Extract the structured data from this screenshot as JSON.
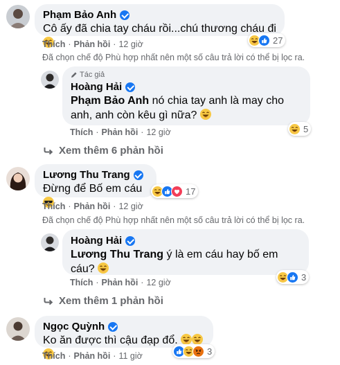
{
  "comments": [
    {
      "author": "Phạm Bảo Anh",
      "text": "Cô ấy đã chia tay cháu rồi...chú thương cháu đi",
      "actions": {
        "like": "Thích",
        "reply": "Phản hồi",
        "time": "12 giờ"
      },
      "reactions_count": "27",
      "filter_note": "Đã chọn chế độ Phù hợp nhất nên một số câu trả lời có thể bị lọc ra.",
      "reply": {
        "author_tag": "Tác giả",
        "author": "Hoàng Hải",
        "mention": "Phạm Bảo Anh",
        "text": " nó chia tay anh là may cho anh, anh còn kêu gì nữa?",
        "actions": {
          "like": "Thích",
          "reply": "Phản hồi",
          "time": "12 giờ"
        },
        "reactions_count": "5"
      },
      "more_replies": "Xem thêm 6 phản hồi"
    },
    {
      "author": "Lương Thu Trang",
      "text": "Đừng để Bố em cáu",
      "actions": {
        "like": "Thích",
        "reply": "Phản hồi",
        "time": "12 giờ"
      },
      "reactions_count": "17",
      "filter_note": "Đã chọn chế độ Phù hợp nhất nên một số câu trả lời có thể bị lọc ra.",
      "reply": {
        "author": "Hoàng Hải",
        "mention": "Lương Thu Trang",
        "text": " ý là em cáu hay bố em cáu?",
        "actions": {
          "like": "Thích",
          "reply": "Phản hồi",
          "time": "12 giờ"
        },
        "reactions_count": "3"
      },
      "more_replies": "Xem thêm 1 phản hồi"
    },
    {
      "author": "Ngọc Quỳnh",
      "text": "Ko ăn được thì cậu đạp đổ.",
      "actions": {
        "like": "Thích",
        "reply": "Phản hồi",
        "time": "11 giờ"
      },
      "reactions_count": "3"
    }
  ],
  "icons": {
    "verified": "verified-badge-icon",
    "reply_arrow": "reply-arrow-icon",
    "author": "pencil-icon",
    "laugh": "laugh-emoji-icon",
    "like": "like-reaction-icon",
    "love": "love-reaction-icon",
    "angry": "angry-reaction-icon",
    "cool": "sunglasses-emoji-icon"
  },
  "colors": {
    "bubble": "#f0f2f5",
    "secondary_text": "#65676b",
    "accent": "#1877f2"
  }
}
